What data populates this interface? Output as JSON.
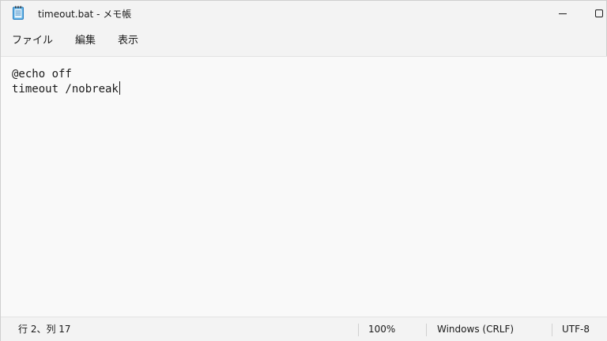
{
  "titlebar": {
    "title": "timeout.bat - メモ帳",
    "app_icon": "notepad-icon",
    "minimize_icon": "minimize-icon",
    "maximize_icon": "maximize-icon"
  },
  "menu": {
    "items": [
      "ファイル",
      "編集",
      "表示"
    ]
  },
  "editor": {
    "lines": [
      "@echo off",
      "timeout /nobreak"
    ]
  },
  "statusbar": {
    "position": "行 2、列 17",
    "zoom": "100%",
    "line_ending": "Windows (CRLF)",
    "encoding": "UTF-8"
  }
}
